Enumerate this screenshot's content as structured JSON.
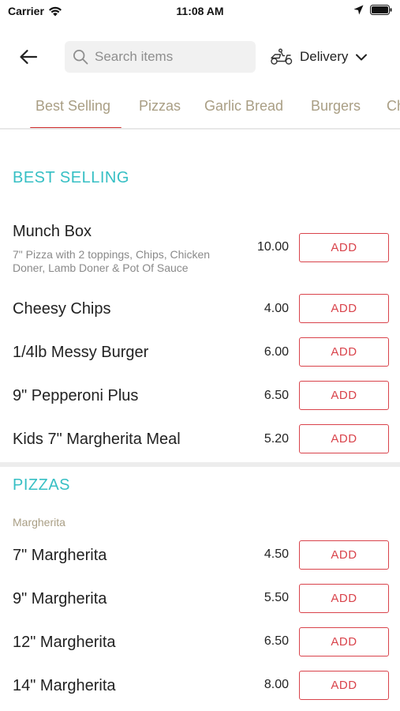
{
  "status_bar": {
    "carrier": "Carrier",
    "time": "11:08 AM",
    "icons": [
      "wifi-icon",
      "location-arrow-icon",
      "battery-icon"
    ]
  },
  "header": {
    "back_icon": "back-arrow-icon",
    "search_placeholder": "Search items",
    "search_icon": "search-icon",
    "delivery_icon": "scooter-icon",
    "delivery_label": "Delivery",
    "delivery_chevron": "chevron-down-icon"
  },
  "tabs": [
    {
      "label": "Best Selling",
      "active": true
    },
    {
      "label": "Pizzas",
      "active": false
    },
    {
      "label": "Garlic Bread",
      "active": false
    },
    {
      "label": "Burgers",
      "active": false
    },
    {
      "label": "Ch",
      "active": false
    }
  ],
  "colors": {
    "accent_teal": "#36bfc4",
    "accent_red": "#d9434b",
    "tab_inactive": "#a99e84",
    "tab_indicator": "#cf2b2b"
  },
  "sections": [
    {
      "title": "BEST SELLING",
      "items": [
        {
          "name": "Munch Box",
          "description": "7\" Pizza with 2 toppings, Chips, Chicken Doner, Lamb Doner & Pot Of Sauce",
          "price": "10.00",
          "button": "ADD"
        },
        {
          "name": "Cheesy Chips",
          "price": "4.00",
          "button": "ADD"
        },
        {
          "name": "1/4lb Messy Burger",
          "price": "6.00",
          "button": "ADD"
        },
        {
          "name": "9\" Pepperoni Plus",
          "price": "6.50",
          "button": "ADD"
        },
        {
          "name": "Kids 7\" Margherita Meal",
          "price": "5.20",
          "button": "ADD"
        }
      ]
    },
    {
      "title": "PIZZAS",
      "subcategory": "Margherita",
      "items": [
        {
          "name": "7\" Margherita",
          "price": "4.50",
          "button": "ADD"
        },
        {
          "name": "9\" Margherita",
          "price": "5.50",
          "button": "ADD"
        },
        {
          "name": "12\" Margherita",
          "price": "6.50",
          "button": "ADD"
        },
        {
          "name": "14\" Margherita",
          "price": "8.00",
          "button": "ADD"
        }
      ]
    }
  ]
}
